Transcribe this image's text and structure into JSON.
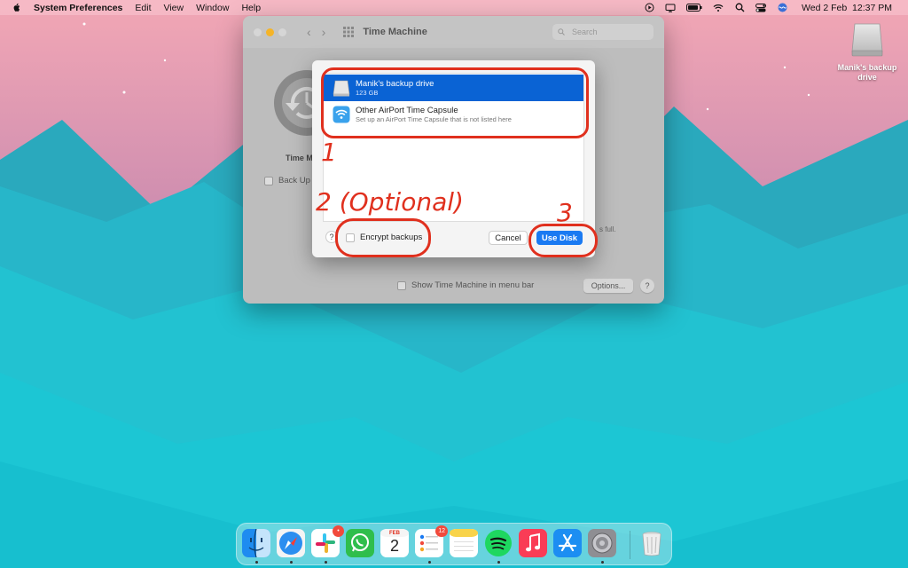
{
  "menubar": {
    "app": "System Preferences",
    "menus": [
      "Edit",
      "View",
      "Window",
      "Help"
    ],
    "datetime": "Wed 2 Feb  12:37 PM",
    "status_icons": [
      "play-circle-icon",
      "display-icon",
      "battery-icon",
      "wifi-icon",
      "search-icon",
      "control-center-icon",
      "siri-icon"
    ]
  },
  "desktop": {
    "drive_label": "Manik's backup drive"
  },
  "prefs": {
    "title": "Time Machine",
    "search_placeholder": "Search",
    "tm_label": "Time M",
    "backup_auto": "Back Up",
    "disk_full_snippet": "s full.",
    "show_in_menubar": "Show Time Machine in menu bar",
    "options_label": "Options...",
    "help_label": "?"
  },
  "sheet": {
    "disks": [
      {
        "name": "Manik's backup drive",
        "sub": "123 GB",
        "selected": true
      },
      {
        "name": "Other AirPort Time Capsule",
        "sub": "Set up an AirPort Time Capsule that is not listed here",
        "selected": false
      }
    ],
    "help_label": "?",
    "encrypt_label": "Encrypt backups",
    "cancel_label": "Cancel",
    "use_disk_label": "Use Disk"
  },
  "annotations": {
    "step1": "1",
    "step2": "2 (Optional)",
    "step3": "3",
    "color": "#e0301e"
  },
  "dock": {
    "apps": [
      "Finder",
      "Safari",
      "Slack",
      "WhatsApp",
      "Calendar",
      "Reminders",
      "Notes",
      "Spotify",
      "Music",
      "App Store",
      "System Preferences",
      "Trash"
    ],
    "calendar_month": "FEB",
    "calendar_day": "2",
    "reminders_badge": "12"
  },
  "colors": {
    "accent": "#1a7af2",
    "selection": "#0a63d4"
  }
}
